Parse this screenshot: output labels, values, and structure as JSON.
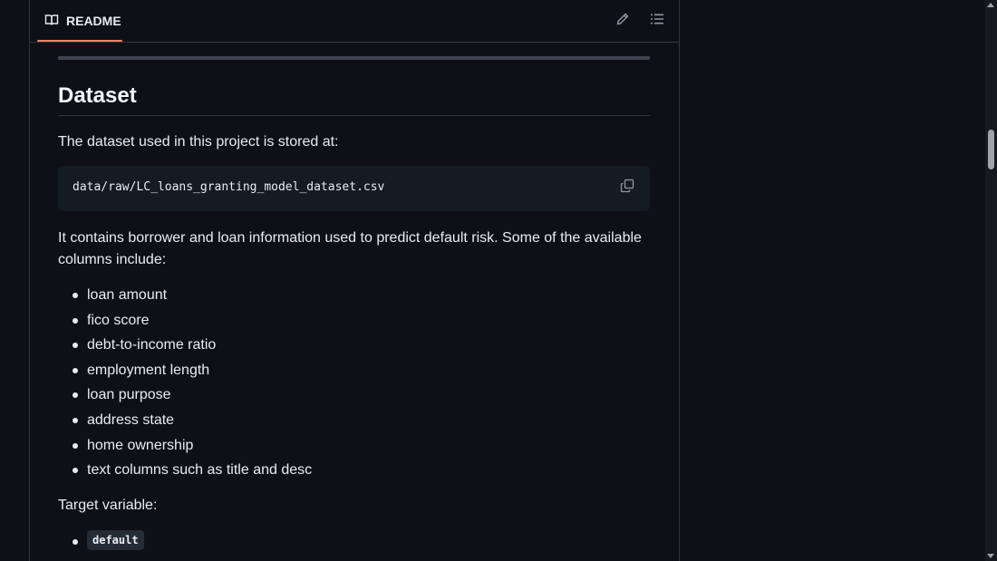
{
  "header": {
    "tab_label": "README",
    "tab_icon": "book-icon",
    "edit_icon": "pencil-icon",
    "outline_icon": "list-unordered-icon"
  },
  "content": {
    "heading": "Dataset",
    "intro": "The dataset used in this project is stored at:",
    "code_path": "data/raw/LC_loans_granting_model_dataset.csv",
    "copy_icon": "copy-icon",
    "description": "It contains borrower and loan information used to predict default risk. Some of the available columns include:",
    "columns": [
      "loan amount",
      "fico score",
      "debt-to-income ratio",
      "employment length",
      "loan purpose",
      "address state",
      "home ownership",
      "text columns such as title and desc"
    ],
    "target_label": "Target variable:",
    "target_values": [
      "default"
    ]
  },
  "colors": {
    "background": "#0d1117",
    "border": "#30363d",
    "accent_underline": "#f78166",
    "code_bg": "#151b23",
    "text": "#e6edf3"
  }
}
